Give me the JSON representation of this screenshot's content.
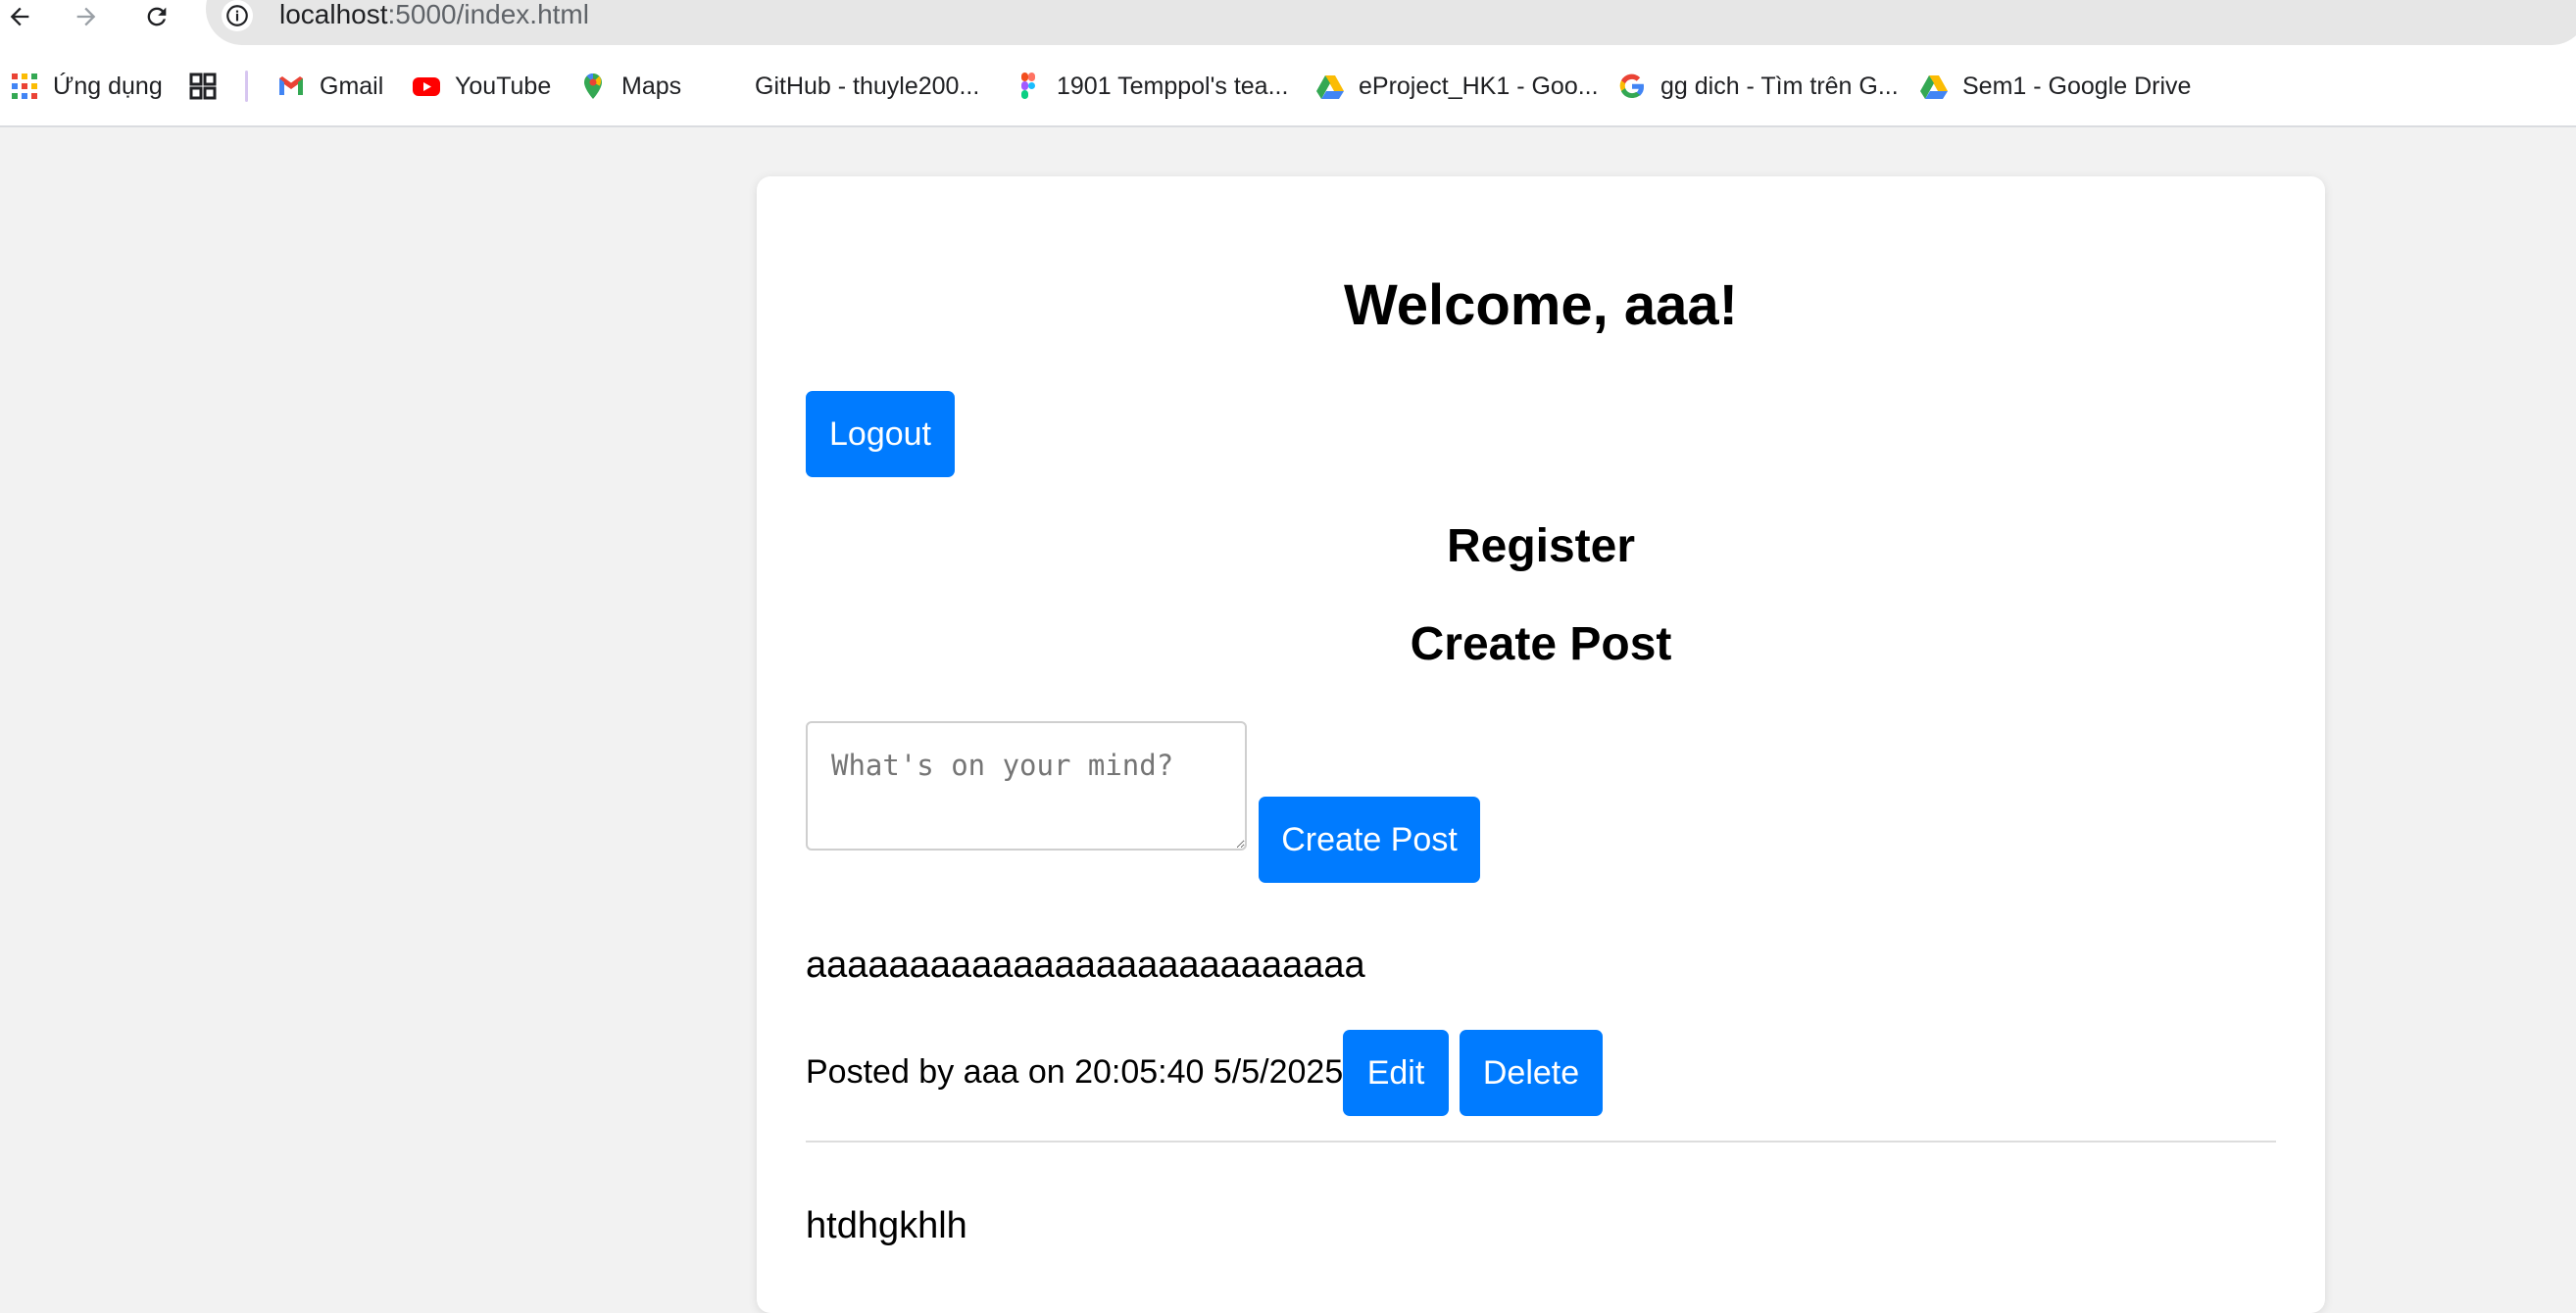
{
  "browser": {
    "url_host": "localhost",
    "url_path": ":5000/index.html",
    "bookmarks": [
      {
        "label": "Ứng dụng",
        "icon": "apps-grid-icon"
      },
      {
        "label": "",
        "icon": "tab-groups-icon"
      },
      {
        "label": "Gmail",
        "icon": "gmail-icon"
      },
      {
        "label": "YouTube",
        "icon": "youtube-icon"
      },
      {
        "label": "Maps",
        "icon": "maps-pin-icon"
      },
      {
        "label": "GitHub - thuyle200...",
        "icon": "github-icon"
      },
      {
        "label": "1901 Temppol's tea...",
        "icon": "figma-icon"
      },
      {
        "label": "eProject_HK1 - Goo...",
        "icon": "google-drive-icon"
      },
      {
        "label": "gg dich - Tìm trên G...",
        "icon": "google-icon"
      },
      {
        "label": "Sem1 - Google Drive",
        "icon": "google-drive-icon"
      }
    ]
  },
  "page": {
    "welcome": "Welcome, aaa!",
    "logout_label": "Logout",
    "register_heading": "Register",
    "create_post_heading": "Create Post",
    "post_placeholder": "What's on your mind?",
    "create_post_button": "Create Post",
    "posts": [
      {
        "content": "aaaaaaaaaaaaaaaaaaaaaaaaaaa",
        "meta": "Posted by aaa on 20:05:40 5/5/2025",
        "edit_label": "Edit",
        "delete_label": "Delete"
      },
      {
        "content": "htdhgkhlh"
      }
    ]
  },
  "colors": {
    "primary_button": "#007bff",
    "page_background": "#f2f2f2",
    "card_background": "#ffffff"
  }
}
